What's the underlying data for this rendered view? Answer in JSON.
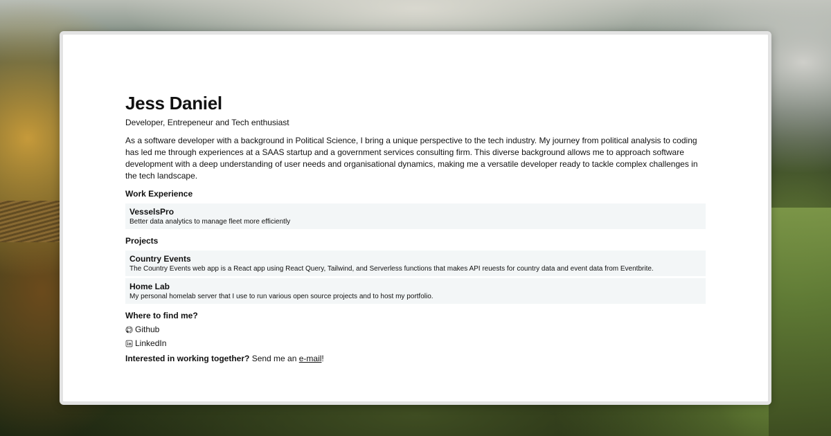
{
  "profile": {
    "name": "Jess Daniel",
    "tagline": "Developer, Entrepeneur and Tech enthusiast",
    "about": "As a software developer with a background in Political Science, I bring a unique perspective to the tech industry. My journey from political analysis to coding has led me through experiences at a SAAS startup and a government services consulting firm. This diverse background allows me to approach software development with a deep understanding of user needs and organisational dynamics, making me a versatile developer ready to tackle complex challenges in the tech landscape."
  },
  "work": {
    "heading": "Work Experience",
    "items": [
      {
        "title": "VesselsPro",
        "description": "Better data analytics to manage fleet more efficiently"
      }
    ]
  },
  "projects": {
    "heading": "Projects",
    "items": [
      {
        "title": "Country Events",
        "description": "The Country Events web app is a React app using React Query, Tailwind, and Serverless functions that makes API reuests for country data and event data from Eventbrite."
      },
      {
        "title": "Home Lab",
        "description": "My personal homelab server that I use to run various open source projects and to host my portfolio."
      }
    ]
  },
  "find_me": {
    "heading": "Where to find me?",
    "links": [
      {
        "label": "Github",
        "icon": "github-icon"
      },
      {
        "label": "LinkedIn",
        "icon": "linkedin-icon"
      }
    ]
  },
  "contact": {
    "lead": "Interested in working together?",
    "text": " Send me an ",
    "link_label": "e-mail",
    "suffix": "!"
  }
}
